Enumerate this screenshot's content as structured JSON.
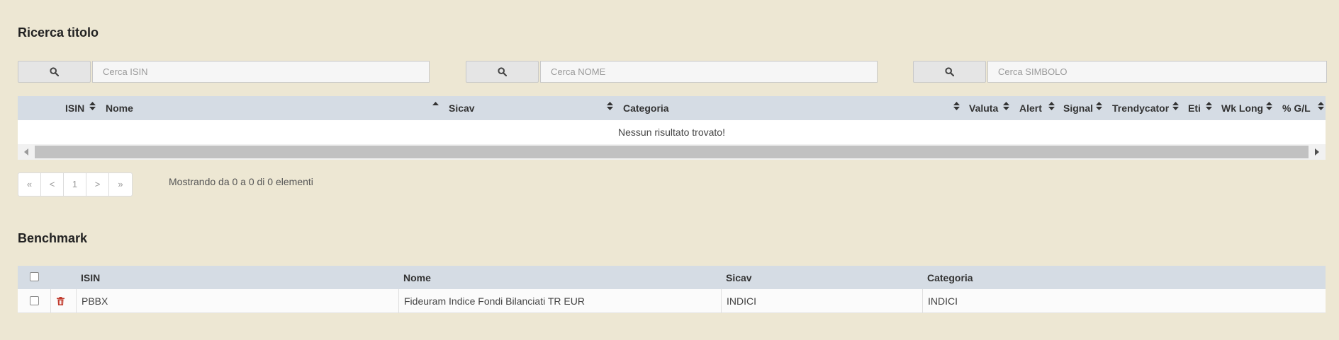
{
  "search_section": {
    "title": "Ricerca titolo",
    "isin_placeholder": "Cerca ISIN",
    "nome_placeholder": "Cerca NOME",
    "simbolo_placeholder": "Cerca SIMBOLO"
  },
  "results_table": {
    "columns": [
      "ISIN",
      "Nome",
      "Sicav",
      "Categoria",
      "Valuta",
      "Alert",
      "Signal",
      "Trendycator",
      "Eti",
      "Wk Long",
      "% G/L"
    ],
    "sort_column": "Nome",
    "sort_direction": "ascending",
    "empty_message": "Nessun risultato trovato!"
  },
  "pagination": {
    "first": "«",
    "prev": "<",
    "current": "1",
    "next": ">",
    "last": "»",
    "info": "Mostrando da 0 a 0 di 0 elementi"
  },
  "benchmark_section": {
    "title": "Benchmark",
    "columns": [
      "ISIN",
      "Nome",
      "Sicav",
      "Categoria"
    ],
    "rows": [
      {
        "isin": "PBBX",
        "nome": "Fideuram Indice Fondi Bilanciati TR EUR",
        "sicav": "INDICI",
        "categoria": "INDICI"
      }
    ]
  },
  "colors": {
    "background": "#ede7d3",
    "header": "#d5dce4",
    "delete_icon": "#c0392b"
  }
}
